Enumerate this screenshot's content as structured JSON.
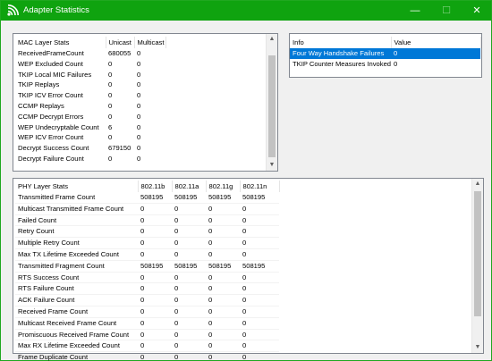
{
  "window": {
    "title": "Adapter Statistics",
    "controls": {
      "minimize": "—",
      "maximize": "☐",
      "close": "✕"
    },
    "accent_color": "#0fa30f",
    "icon": "wifi-signal-icon"
  },
  "mac": {
    "headers": [
      "MAC Layer Stats",
      "Unicast",
      "Multicast"
    ],
    "rows": [
      [
        "ReceivedFrameCount",
        "680055",
        "0"
      ],
      [
        "WEP Excluded Count",
        "0",
        "0"
      ],
      [
        "TKIP Local MIC Failures",
        "0",
        "0"
      ],
      [
        "TKIP Replays",
        "0",
        "0"
      ],
      [
        "TKIP ICV Error Count",
        "0",
        "0"
      ],
      [
        "CCMP Replays",
        "0",
        "0"
      ],
      [
        "CCMP Decrypt Errors",
        "0",
        "0"
      ],
      [
        "WEP Undecryptable Count",
        "6",
        "0"
      ],
      [
        "WEP ICV Error Count",
        "0",
        "0"
      ],
      [
        "Decrypt Success Count",
        "679150",
        "0"
      ],
      [
        "Decrypt Failure Count",
        "0",
        "0"
      ]
    ]
  },
  "info": {
    "headers": [
      "Info",
      "Value"
    ],
    "rows": [
      [
        "Four Way Handshake Failures",
        "0"
      ],
      [
        "TKIP Counter Measures Invoked",
        "0"
      ]
    ],
    "selected_row": 0,
    "selection_color": "#0078d7"
  },
  "phy": {
    "headers": [
      "PHY Layer Stats",
      "802.11b",
      "802.11a",
      "802.11g",
      "802.11n"
    ],
    "rows": [
      [
        "Transmitted Frame Count",
        "508195",
        "508195",
        "508195",
        "508195"
      ],
      [
        "Multicast Transmitted Frame Count",
        "0",
        "0",
        "0",
        "0"
      ],
      [
        "Failed Count",
        "0",
        "0",
        "0",
        "0"
      ],
      [
        "Retry Count",
        "0",
        "0",
        "0",
        "0"
      ],
      [
        "Multiple Retry Count",
        "0",
        "0",
        "0",
        "0"
      ],
      [
        "Max TX Lifetime Exceeded Count",
        "0",
        "0",
        "0",
        "0"
      ],
      [
        "Transmitted Fragment Count",
        "508195",
        "508195",
        "508195",
        "508195"
      ],
      [
        "RTS Success Count",
        "0",
        "0",
        "0",
        "0"
      ],
      [
        "RTS Failure Count",
        "0",
        "0",
        "0",
        "0"
      ],
      [
        "ACK Failure Count",
        "0",
        "0",
        "0",
        "0"
      ],
      [
        "Received Frame Count",
        "0",
        "0",
        "0",
        "0"
      ],
      [
        "Multicast Received Frame Count",
        "0",
        "0",
        "0",
        "0"
      ],
      [
        "Promiscuous Received Frame Count",
        "0",
        "0",
        "0",
        "0"
      ],
      [
        "Max RX Lifetime Exceeded Count",
        "0",
        "0",
        "0",
        "0"
      ],
      [
        "Frame Duplicate Count",
        "0",
        "0",
        "0",
        "0"
      ]
    ]
  }
}
